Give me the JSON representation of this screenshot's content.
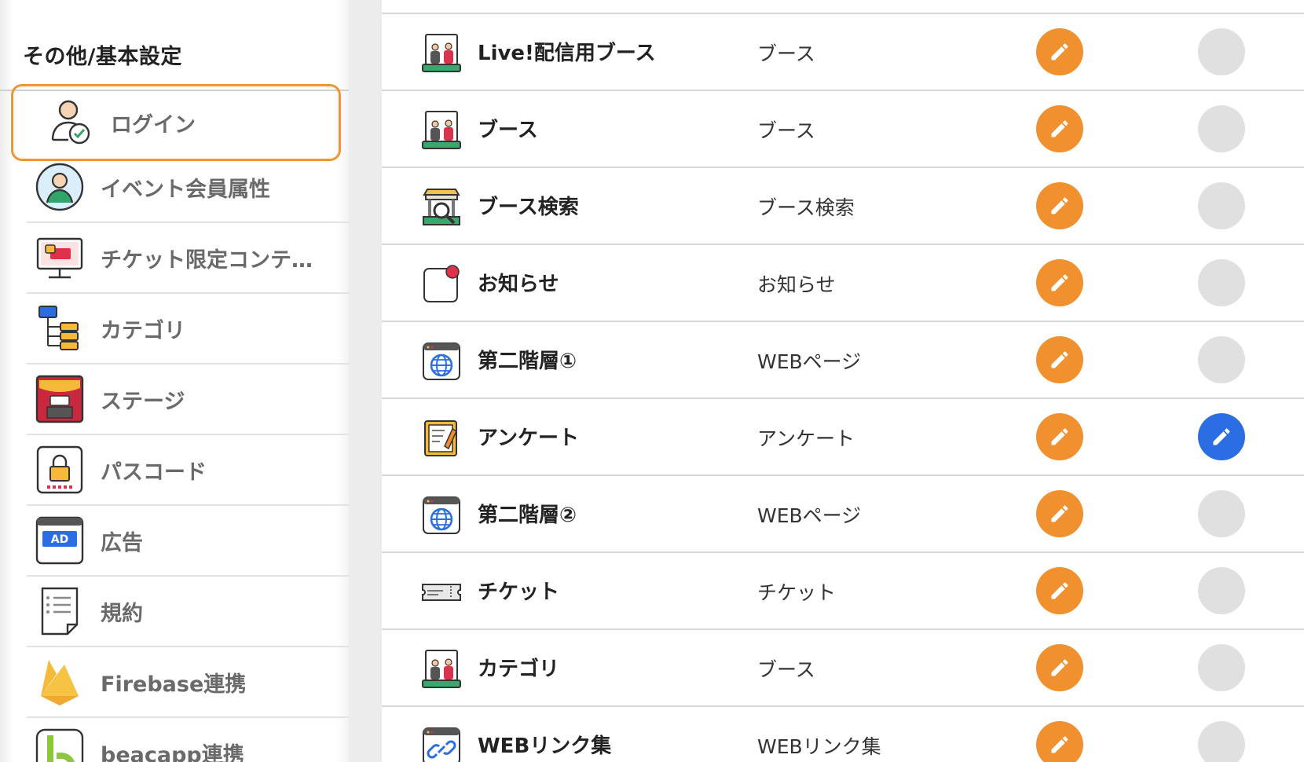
{
  "sidebar": {
    "heading": "その他/基本設定",
    "items": [
      {
        "label": "ログイン",
        "icon": "user-check-icon"
      },
      {
        "label": "イベント会員属性",
        "icon": "member-icon"
      },
      {
        "label": "チケット限定コンテ…",
        "icon": "ticket-monitor-icon"
      },
      {
        "label": "カテゴリ",
        "icon": "tree-icon"
      },
      {
        "label": "ステージ",
        "icon": "stage-icon"
      },
      {
        "label": "パスコード",
        "icon": "lock-icon"
      },
      {
        "label": "広告",
        "icon": "ad-icon"
      },
      {
        "label": "規約",
        "icon": "document-icon"
      },
      {
        "label": "Firebase連携",
        "icon": "firebase-icon"
      },
      {
        "label": "beacapp連携",
        "icon": "beacapp-icon"
      }
    ]
  },
  "rows": [
    {
      "name": "Live!配信用ブース",
      "type": "ブース",
      "icon": "booth-icon",
      "second_active": false
    },
    {
      "name": "ブース",
      "type": "ブース",
      "icon": "booth-icon",
      "second_active": false
    },
    {
      "name": "ブース検索",
      "type": "ブース検索",
      "icon": "booth-search-icon",
      "second_active": false
    },
    {
      "name": "お知らせ",
      "type": "お知らせ",
      "icon": "notification-icon",
      "second_active": false
    },
    {
      "name": "第二階層①",
      "type": "WEBページ",
      "icon": "globe-icon",
      "second_active": false
    },
    {
      "name": "アンケート",
      "type": "アンケート",
      "icon": "survey-icon",
      "second_active": true
    },
    {
      "name": "第二階層②",
      "type": "WEBページ",
      "icon": "globe-icon",
      "second_active": false
    },
    {
      "name": "チケット",
      "type": "チケット",
      "icon": "ticket-icon",
      "second_active": false
    },
    {
      "name": "カテゴリ",
      "type": "ブース",
      "icon": "booth-icon",
      "second_active": false
    },
    {
      "name": "WEBリンク集",
      "type": "WEBリンク集",
      "icon": "link-icon",
      "second_active": false
    }
  ],
  "colors": {
    "accent_orange": "#f0902f",
    "active_blue": "#2b6de3",
    "inactive_gray": "#e0e0e0",
    "selected_border": "#f09535"
  }
}
